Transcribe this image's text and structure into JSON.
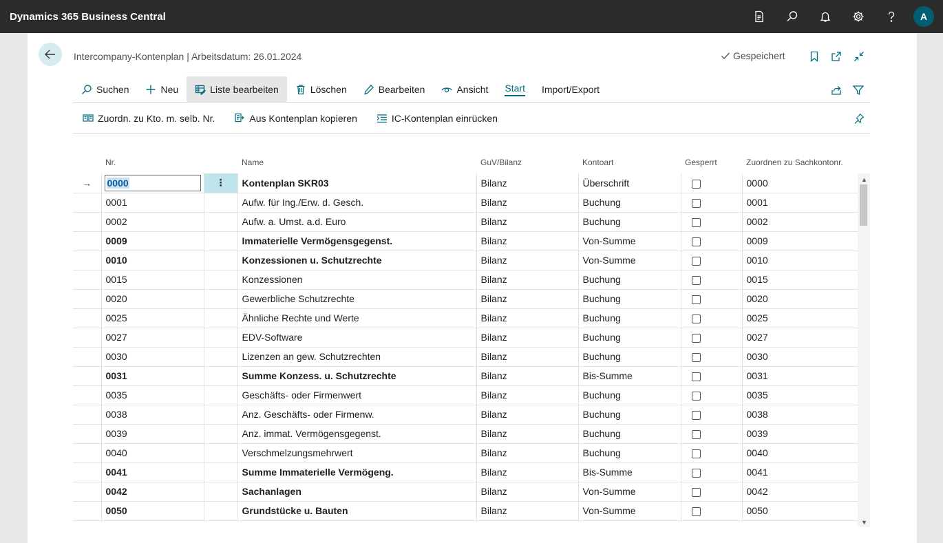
{
  "app": {
    "title": "Dynamics 365 Business Central",
    "avatar_initial": "A"
  },
  "topbar_icons": [
    "document-icon",
    "search-icon",
    "bell-icon",
    "gear-icon",
    "help-icon"
  ],
  "page": {
    "title": "Intercompany-Kontenplan | Arbeitsdatum: 26.01.2024",
    "saved_label": "Gespeichert"
  },
  "actions": {
    "search": "Suchen",
    "new": "Neu",
    "edit_list": "Liste bearbeiten",
    "delete": "Löschen",
    "edit": "Bearbeiten",
    "view": "Ansicht",
    "start": "Start",
    "import_export": "Import/Export"
  },
  "subactions": {
    "map": "Zuordn. zu Kto. m. selb. Nr.",
    "copy": "Aus Kontenplan kopieren",
    "indent": "IC-Kontenplan einrücken"
  },
  "columns": {
    "nr": "Nr.",
    "name": "Name",
    "guv": "GuV/Bilanz",
    "kontoart": "Kontoart",
    "gesperrt": "Gesperrt",
    "zuordnen": "Zuordnen zu Sachkontonr."
  },
  "rows": [
    {
      "nr": "0000",
      "name": "Kontenplan SKR03",
      "guv": "Bilanz",
      "kontoart": "Überschrift",
      "zuordnen": "0000",
      "bold": true,
      "selected": true
    },
    {
      "nr": "0001",
      "name": "Aufw. für Ing./Erw. d. Gesch.",
      "guv": "Bilanz",
      "kontoart": "Buchung",
      "zuordnen": "0001",
      "bold": false
    },
    {
      "nr": "0002",
      "name": "Aufw. a. Umst. a.d. Euro",
      "guv": "Bilanz",
      "kontoart": "Buchung",
      "zuordnen": "0002",
      "bold": false
    },
    {
      "nr": "0009",
      "name": "Immaterielle Vermögensgegenst.",
      "guv": "Bilanz",
      "kontoart": "Von-Summe",
      "zuordnen": "0009",
      "bold": true
    },
    {
      "nr": "0010",
      "name": "Konzessionen u. Schutzrechte",
      "guv": "Bilanz",
      "kontoart": "Von-Summe",
      "zuordnen": "0010",
      "bold": true
    },
    {
      "nr": "0015",
      "name": "Konzessionen",
      "guv": "Bilanz",
      "kontoart": "Buchung",
      "zuordnen": "0015",
      "bold": false
    },
    {
      "nr": "0020",
      "name": "Gewerbliche Schutzrechte",
      "guv": "Bilanz",
      "kontoart": "Buchung",
      "zuordnen": "0020",
      "bold": false
    },
    {
      "nr": "0025",
      "name": "Ähnliche Rechte und Werte",
      "guv": "Bilanz",
      "kontoart": "Buchung",
      "zuordnen": "0025",
      "bold": false
    },
    {
      "nr": "0027",
      "name": "EDV-Software",
      "guv": "Bilanz",
      "kontoart": "Buchung",
      "zuordnen": "0027",
      "bold": false
    },
    {
      "nr": "0030",
      "name": "Lizenzen an gew. Schutzrechten",
      "guv": "Bilanz",
      "kontoart": "Buchung",
      "zuordnen": "0030",
      "bold": false
    },
    {
      "nr": "0031",
      "name": "Summe Konzess. u. Schutzrechte",
      "guv": "Bilanz",
      "kontoart": "Bis-Summe",
      "zuordnen": "0031",
      "bold": true
    },
    {
      "nr": "0035",
      "name": "Geschäfts- oder Firmenwert",
      "guv": "Bilanz",
      "kontoart": "Buchung",
      "zuordnen": "0035",
      "bold": false
    },
    {
      "nr": "0038",
      "name": "Anz. Geschäfts- oder Firmenw.",
      "guv": "Bilanz",
      "kontoart": "Buchung",
      "zuordnen": "0038",
      "bold": false
    },
    {
      "nr": "0039",
      "name": "Anz. immat. Vermögensgegenst.",
      "guv": "Bilanz",
      "kontoart": "Buchung",
      "zuordnen": "0039",
      "bold": false
    },
    {
      "nr": "0040",
      "name": "Verschmelzungsmehrwert",
      "guv": "Bilanz",
      "kontoart": "Buchung",
      "zuordnen": "0040",
      "bold": false
    },
    {
      "nr": "0041",
      "name": "Summe Immaterielle Vermögeng.",
      "guv": "Bilanz",
      "kontoart": "Bis-Summe",
      "zuordnen": "0041",
      "bold": true
    },
    {
      "nr": "0042",
      "name": "Sachanlagen",
      "guv": "Bilanz",
      "kontoart": "Von-Summe",
      "zuordnen": "0042",
      "bold": true
    },
    {
      "nr": "0050",
      "name": "Grundstücke u. Bauten",
      "guv": "Bilanz",
      "kontoart": "Von-Summe",
      "zuordnen": "0050",
      "bold": true
    }
  ]
}
